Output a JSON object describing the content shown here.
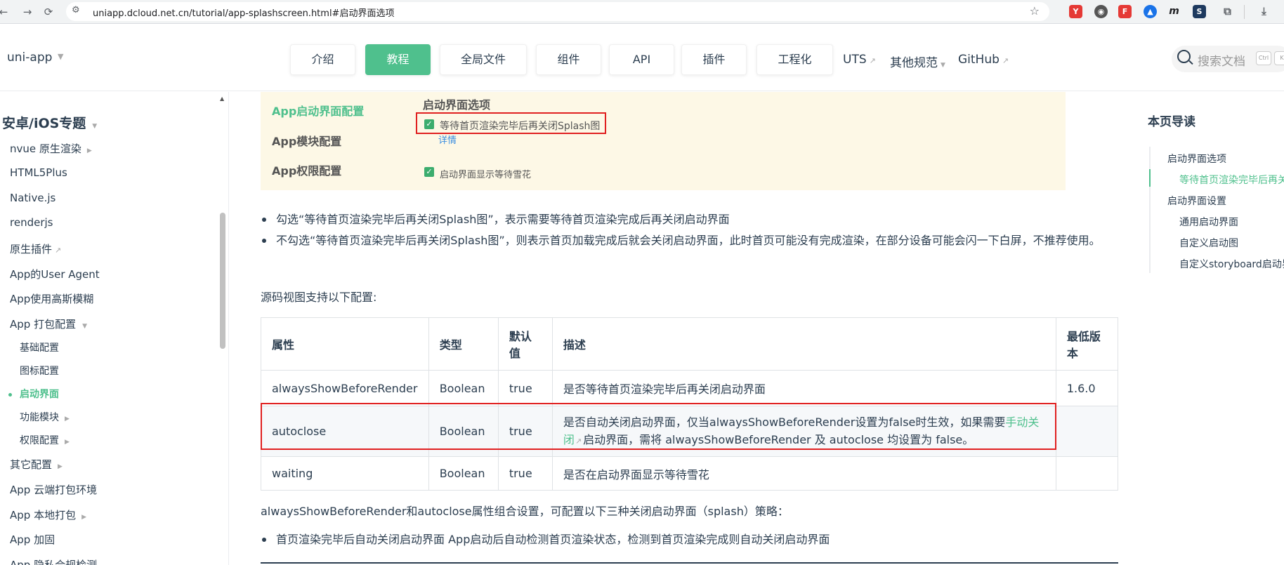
{
  "browser": {
    "url": "uniapp.dcloud.net.cn/tutorial/app-splashscreen.html#启动界面选项",
    "extension_labels": [
      "Y",
      "m"
    ]
  },
  "header": {
    "logo": "uni-app",
    "tabs": [
      {
        "label": "介绍"
      },
      {
        "label": "教程"
      },
      {
        "label": "全局文件"
      },
      {
        "label": "组件"
      },
      {
        "label": "API"
      },
      {
        "label": "插件"
      },
      {
        "label": "工程化"
      }
    ],
    "links": [
      {
        "label": "UTS"
      },
      {
        "label": "其他规范"
      },
      {
        "label": "GitHub"
      }
    ],
    "search_placeholder": "搜索文档",
    "kbd": [
      "Ctrl",
      "K"
    ]
  },
  "sidebar": {
    "section_title": "安卓/iOS专题",
    "items": [
      {
        "label": "nvue 原生渲染"
      },
      {
        "label": "HTML5Plus"
      },
      {
        "label": "Native.js"
      },
      {
        "label": "renderjs"
      },
      {
        "label": "原生插件"
      },
      {
        "label": "App的User Agent"
      },
      {
        "label": "App使用高斯模糊"
      },
      {
        "label": "App 打包配置"
      },
      {
        "label": "基础配置"
      },
      {
        "label": "图标配置"
      },
      {
        "label": "启动界面"
      },
      {
        "label": "功能模块"
      },
      {
        "label": "权限配置"
      },
      {
        "label": "其它配置"
      },
      {
        "label": "App 云端打包环境"
      },
      {
        "label": "App 本地打包"
      },
      {
        "label": "App 加固"
      },
      {
        "label": "App 隐私合规检测"
      }
    ]
  },
  "screenshot": {
    "menu": [
      "App启动界面配置",
      "App模块配置",
      "App权限配置"
    ],
    "options_title": "启动界面选项",
    "option1": "等待首页渲染完毕后再关闭Splash图",
    "detail_link": "详情",
    "option2": "启动界面显示等待雪花"
  },
  "content": {
    "bullets": [
      "勾选“等待首页渲染完毕后再关闭Splash图”，表示需要等待首页渲染完成后再关闭启动界面",
      "不勾选“等待首页渲染完毕后再关闭Splash图”，则表示首页加载完成后就会关闭启动界面，此时首页可能没有完成渲染，在部分设备可能会闪一下白屏，不推荐使用。"
    ],
    "table_intro": "源码视图支持以下配置:",
    "table": {
      "headers": [
        "属性",
        "类型",
        "默认值",
        "描述",
        "最低版本"
      ],
      "rows": [
        {
          "prop": "alwaysShowBeforeRender",
          "type": "Boolean",
          "default": "true",
          "desc": "是否等待首页渲染完毕后再关闭启动界面",
          "version": "1.6.0"
        },
        {
          "prop": "autoclose",
          "type": "Boolean",
          "default": "true",
          "desc_before": "是否自动关闭启动界面，仅当alwaysShowBeforeRender设置为false时生效，如果需要",
          "desc_link": "手动关闭",
          "desc_after": "启动界面，需将 alwaysShowBeforeRender 及 autoclose 均设置为 false。",
          "version": ""
        },
        {
          "prop": "waiting",
          "type": "Boolean",
          "default": "true",
          "desc": "是否在启动界面显示等待雪花",
          "version": ""
        }
      ]
    },
    "combo_intro": "alwaysShowBeforeRender和autoclose属性组合设置，可配置以下三种关闭启动界面（splash）策略：",
    "strategy1": "首页渲染完毕后自动关闭启动界面 App启动后自动检测首页渲染状态，检测到首页渲染完成则自动关闭启动界面"
  },
  "toc": {
    "title": "本页导读",
    "items": [
      {
        "label": "启动界面选项"
      },
      {
        "label": "等待首页渲染完毕后再关闭Splash图"
      },
      {
        "label": "启动界面设置"
      },
      {
        "label": "通用启动界面"
      },
      {
        "label": "自定义启动图"
      },
      {
        "label": "自定义storyboard启动界面"
      }
    ]
  }
}
